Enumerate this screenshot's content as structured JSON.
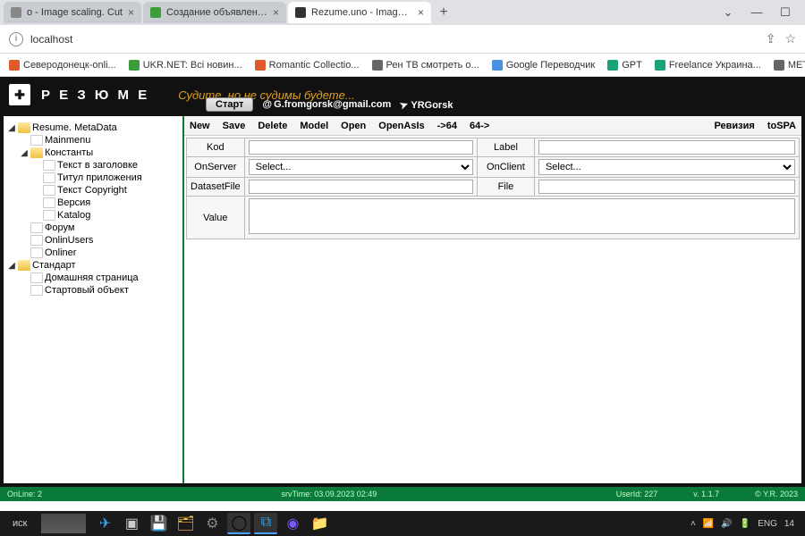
{
  "browser": {
    "tabs": [
      {
        "label": "o - Image scaling. Cut",
        "favcolor": "#888"
      },
      {
        "label": "Создание объявления об услуг",
        "favcolor": "#3a9d3a"
      },
      {
        "label": "Rezume.uno - Image scaling. Cut",
        "favcolor": "#333"
      }
    ],
    "address": "localhost",
    "bookmarks": [
      {
        "label": "Северодонецк-onli...",
        "color": "#e05a2a"
      },
      {
        "label": "UKR.NET: Всі новин...",
        "color": "#3a9d3a"
      },
      {
        "label": "Romantic Collectio...",
        "color": "#e05a2a"
      },
      {
        "label": "Рен ТВ смотреть о...",
        "color": "#666"
      },
      {
        "label": "Google Переводчик",
        "color": "#4a90e2"
      },
      {
        "label": "GPT",
        "color": "#1aa37a"
      },
      {
        "label": "Freelance Украина...",
        "color": "#1aa37a"
      },
      {
        "label": "METANIT.COM - Са...",
        "color": "#666"
      }
    ]
  },
  "app": {
    "brand": "Р Е З Ю М Е",
    "motto": "Судите, но не судимы будете...",
    "start": "Старт",
    "email": "G.fromgorsk@gmail.com",
    "tg": "YRGorsk",
    "toolbar": {
      "new": "New",
      "save": "Save",
      "delete": "Delete",
      "model": "Model",
      "open": "Open",
      "openasis": "OpenAsIs",
      "to64": "->64",
      "from64": "64->",
      "revision": "Ревизия",
      "tospa": "toSPA"
    },
    "form": {
      "kod_lbl": "Kod",
      "kod_val": "",
      "label_lbl": "Label",
      "label_val": "",
      "onserver_lbl": "OnServer",
      "onserver_val": "Select...",
      "onclient_lbl": "OnClient",
      "onclient_val": "Select...",
      "datasetfile_lbl": "DatasetFile",
      "datasetfile_val": "",
      "file_lbl": "File",
      "file_val": "",
      "value_lbl": "Value",
      "value_val": ""
    },
    "tree": {
      "n0": "Resume. MetaData",
      "n1": "Mainmenu",
      "n2": "Константы",
      "n3": "Текст в заголовке",
      "n4": "Титул приложения",
      "n5": "Текст Copyright",
      "n6": "Версия",
      "n7": "Katalog",
      "n8": "Форум",
      "n9": "OnlinUsers",
      "n10": "Onliner",
      "n11": "Стандарт",
      "n12": "Домашняя страница",
      "n13": "Стартовый объект"
    },
    "status": {
      "online": "OnLine: 2",
      "srvtime": "srvTime: 03.09.2023 02:49",
      "userid": "UserId: 227",
      "version": "v. 1.1.7",
      "copy": "© Y.R. 2023"
    }
  },
  "taskbar": {
    "search": "иск",
    "lang": "ENG",
    "time": "14"
  }
}
